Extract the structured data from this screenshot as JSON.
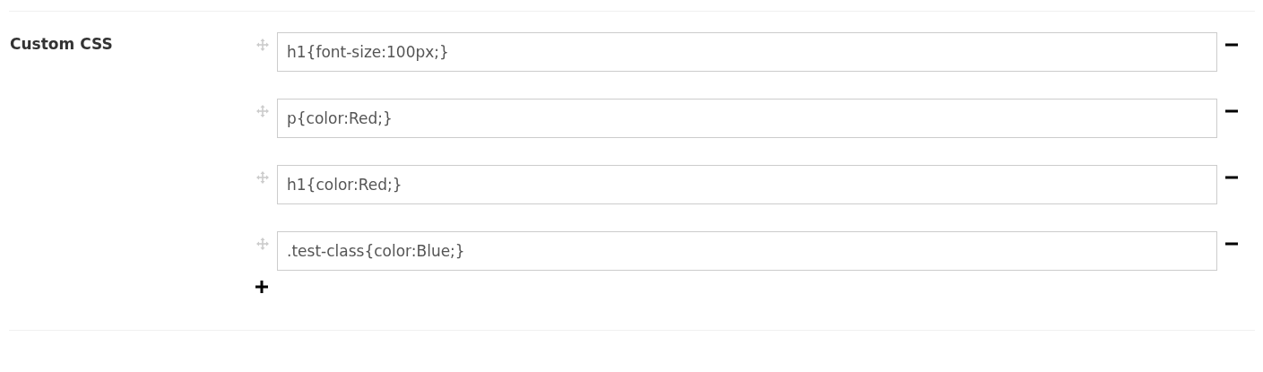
{
  "section": {
    "label": "Custom CSS",
    "rules": [
      {
        "value": "h1{font-size:100px;}"
      },
      {
        "value": "p{color:Red;}"
      },
      {
        "value": "h1{color:Red;}"
      },
      {
        "value": ".test-class{color:Blue;}"
      }
    ]
  }
}
